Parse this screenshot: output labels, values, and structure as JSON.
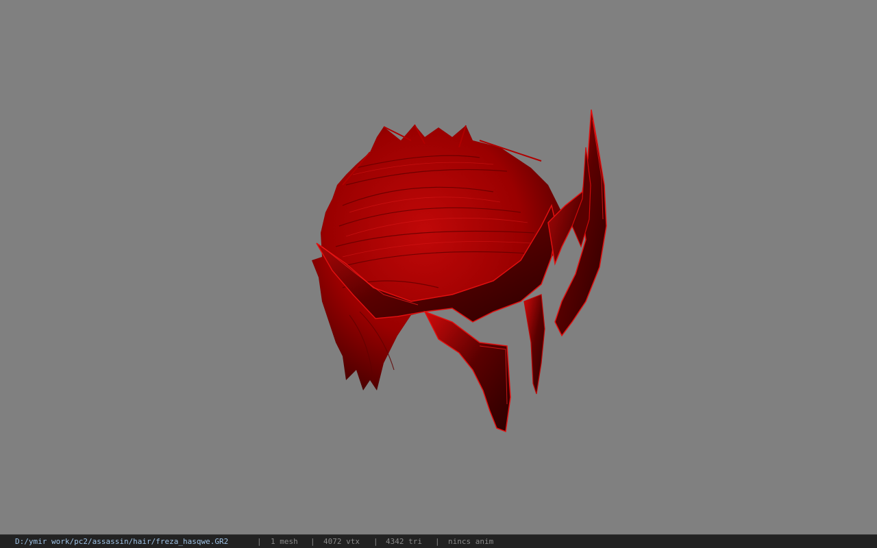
{
  "viewport": {
    "background_color": "#808080",
    "model": {
      "kind": "hair-mesh-with-horned-headpiece",
      "primary_color": "#b00000",
      "shadow_color": "#3a0000",
      "highlight_color": "#e01010"
    }
  },
  "status_bar": {
    "file_path": "D:/ymir work/pc2/assassin/hair/freza_hasqwe.GR2",
    "separator": "|",
    "mesh_count": "1 mesh",
    "vertex_count": "4072 vtx",
    "triangle_count": "4342 tri",
    "anim_label": "nincs anim",
    "path_color": "#9fc3e6",
    "text_color": "#8a8a8a"
  }
}
